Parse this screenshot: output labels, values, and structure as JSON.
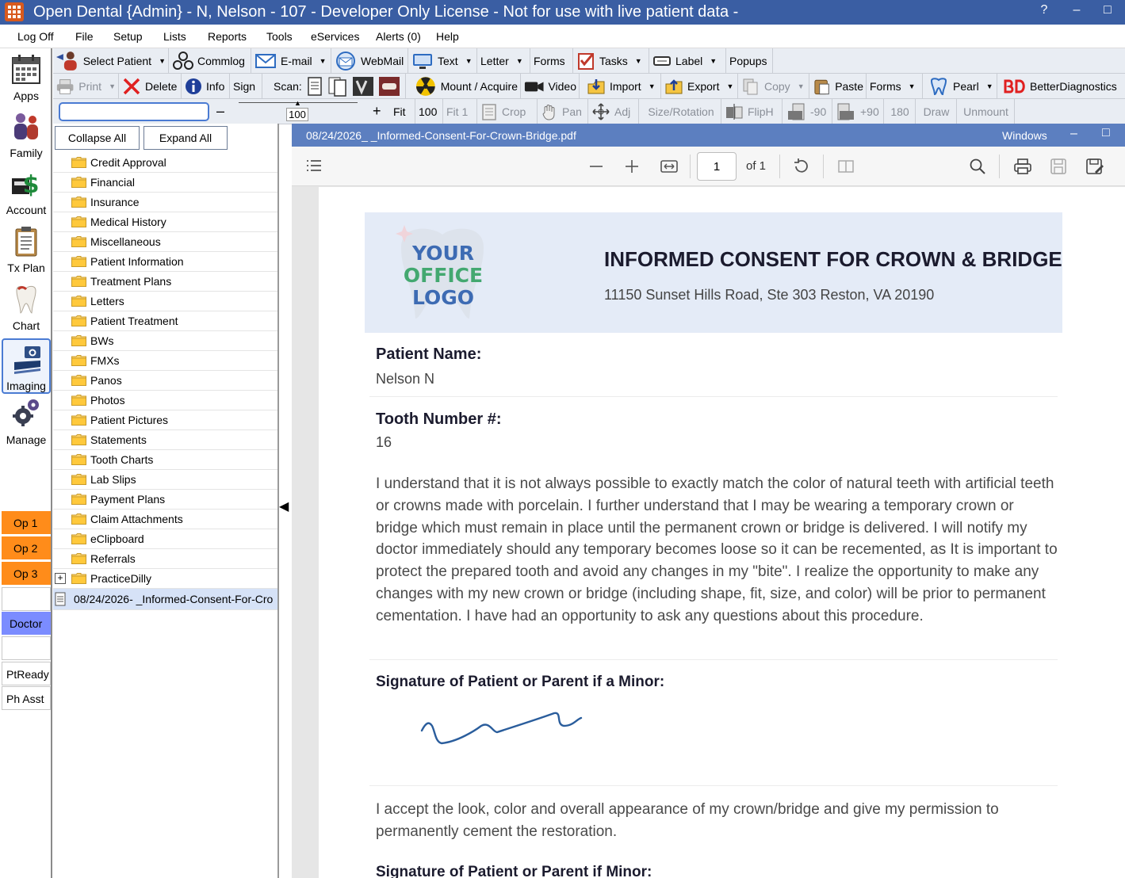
{
  "window": {
    "title": "Open Dental {Admin} - N, Nelson - 107 - Developer Only License - Not for use with live patient data -",
    "help": "?",
    "minimize": "–",
    "maximize": "□"
  },
  "menu": [
    "Log Off",
    "File",
    "Setup",
    "Lists",
    "Reports",
    "Tools",
    "eServices",
    "Alerts (0)",
    "Help"
  ],
  "modules": [
    {
      "label": "Apps",
      "icon": "calendar-icon"
    },
    {
      "label": "Family",
      "icon": "family-icon"
    },
    {
      "label": "Account",
      "icon": "money-icon"
    },
    {
      "label": "Tx Plan",
      "icon": "clipboard-icon"
    },
    {
      "label": "Chart",
      "icon": "tooth-icon"
    },
    {
      "label": "Imaging",
      "icon": "camera-icon",
      "selected": true
    },
    {
      "label": "Manage",
      "icon": "gears-icon"
    }
  ],
  "operatories": [
    "Op 1",
    "Op 2",
    "Op 3",
    "",
    "Doctor",
    "",
    "PtReady",
    "Ph Asst"
  ],
  "toolbar1": {
    "select_patient": "Select Patient",
    "commlog": "Commlog",
    "email": "E-mail",
    "webmail": "WebMail",
    "text": "Text",
    "letter": "Letter",
    "forms": "Forms",
    "tasks": "Tasks",
    "label": "Label",
    "popups": "Popups"
  },
  "toolbar2": {
    "print": "Print",
    "delete": "Delete",
    "info": "Info",
    "sign": "Sign",
    "scan": "Scan:",
    "mount": "Mount / Acquire",
    "video": "Video",
    "import": "Import",
    "export": "Export",
    "copy": "Copy",
    "paste": "Paste",
    "forms": "Forms",
    "pearl": "Pearl",
    "better": "BetterDiagnostics"
  },
  "toolbar3": {
    "minus": "–",
    "zoom": "100",
    "plus": "+",
    "fit": "Fit",
    "hundred": "100",
    "fit1": "Fit 1",
    "crop": "Crop",
    "pan": "Pan",
    "adj": "Adj",
    "size_rotation": "Size/Rotation",
    "fliph": "FlipH",
    "rot_left": "-90",
    "rot_right": "+90",
    "rot180": "180",
    "draw": "Draw",
    "unmount": "Unmount"
  },
  "panel": {
    "collapse": "Collapse All",
    "expand": "Expand All",
    "folders": [
      "Credit Approval",
      "Financial",
      "Insurance",
      "Medical History",
      "Miscellaneous",
      "Patient Information",
      "Treatment Plans",
      "Letters",
      "Patient Treatment",
      "BWs",
      "FMXs",
      "Panos",
      "Photos",
      "Patient Pictures",
      "Statements",
      "Tooth Charts",
      "Lab Slips",
      "Payment Plans",
      "Claim Attachments",
      "eClipboard",
      "Referrals",
      "PracticeDilly"
    ],
    "expander": "+",
    "document": "08/24/2026- _Informed-Consent-For-Cro"
  },
  "viewer": {
    "title": "08/24/2026_ _Informed-Consent-For-Crown-Bridge.pdf",
    "window_label": "Windows",
    "page_num": "1",
    "page_of": "of 1"
  },
  "document": {
    "logo": [
      "YOUR",
      "OFFICE",
      "LOGO"
    ],
    "heading": "INFORMED CONSENT FOR CROWN & BRIDGE",
    "address": "11150 Sunset Hills Road, Ste 303 Reston, VA 20190",
    "patient_label": "Patient Name:",
    "patient_value": "Nelson N",
    "tooth_label": "Tooth Number #:",
    "tooth_value": "16",
    "paragraph": "I understand that it is not always possible to exactly match the color of natural teeth with artificial teeth or crowns made with porcelain. I further understand that I may be wearing a temporary crown or bridge which must remain in place until the permanent crown or bridge is delivered. I will notify my doctor immediately should any temporary becomes loose so it can be recemented, as It is important to protect the prepared tooth and avoid any changes in my \"bite\". I realize the opportunity to make any changes with my new crown or bridge (including shape, fit, size, and color) will be prior to permanent cementation. I have had an opportunity to ask any questions about this procedure.",
    "sig1_label": "Signature of Patient or Parent if a Minor:",
    "accept": "I accept the look, color and overall appearance of my crown/bridge and give my permission to permanently cement the restoration.",
    "sig2_label": "Signature of Patient or Parent if Minor:"
  },
  "colors": {
    "titlebar": "#3a5ea3",
    "viewer_title": "#5c7fc0",
    "op_orange": "#ff8c1a",
    "doctor_blue": "#7b8cff",
    "header_band": "#e4ebf7",
    "logo_blue": "#3d6bb3",
    "logo_green": "#43a870",
    "signature": "#2a5d9c"
  }
}
